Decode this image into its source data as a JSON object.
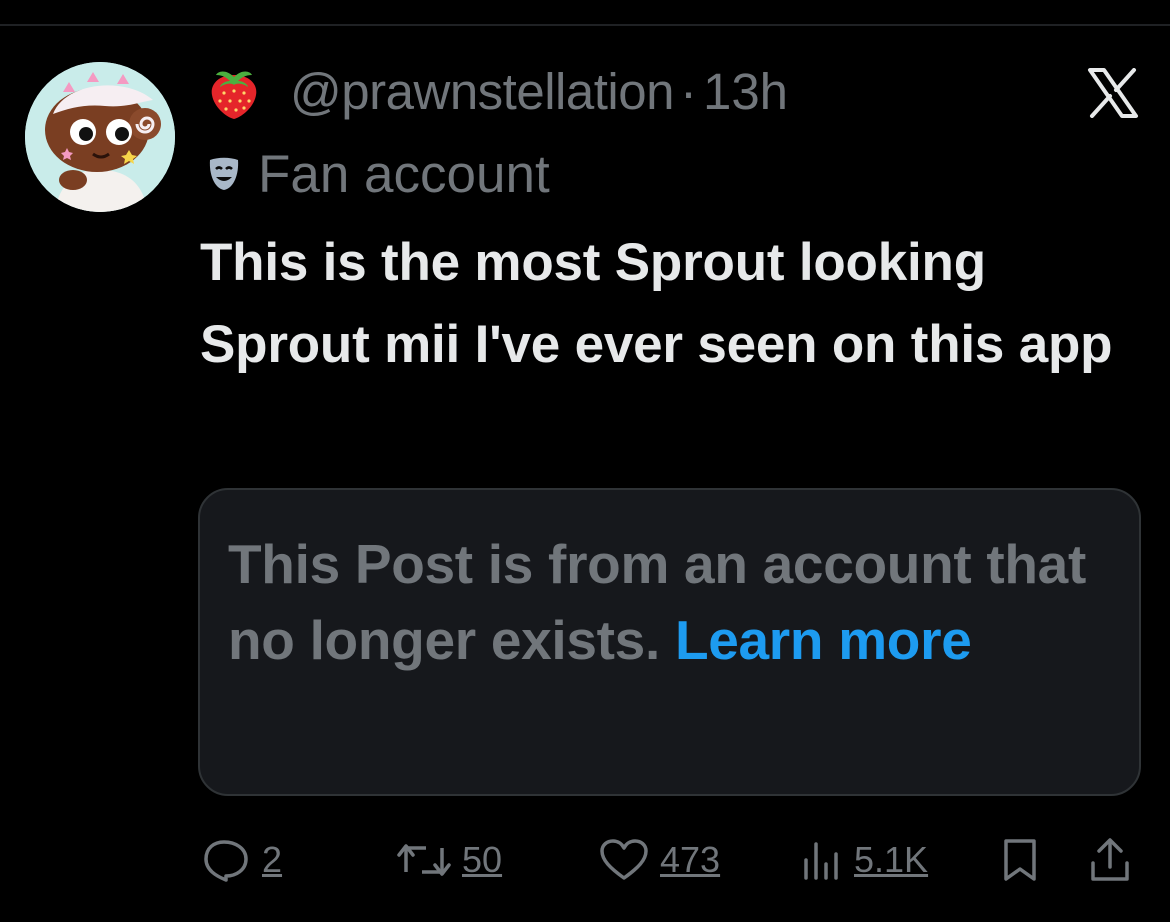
{
  "post": {
    "author_handle": "@prawnstellation",
    "separator": "·",
    "time": "13h",
    "author_emoji": "strawberry-icon",
    "label_icon": "theater-mask-icon",
    "label": "Fan account",
    "text": "This is the most Sprout looking Sprout mii I've ever seen on this app"
  },
  "quoted_post": {
    "unavailable_text": "This Post is from an account that no longer exists.",
    "learn_more": "Learn more"
  },
  "actions": {
    "replies": "2",
    "reposts": "50",
    "likes": "473",
    "views": "5.1K"
  },
  "colors": {
    "background": "#000000",
    "text_primary": "#e7e9ea",
    "text_secondary": "#71767b",
    "link": "#1d9bf0",
    "card_background": "#16181c",
    "card_border": "#2f3336"
  }
}
